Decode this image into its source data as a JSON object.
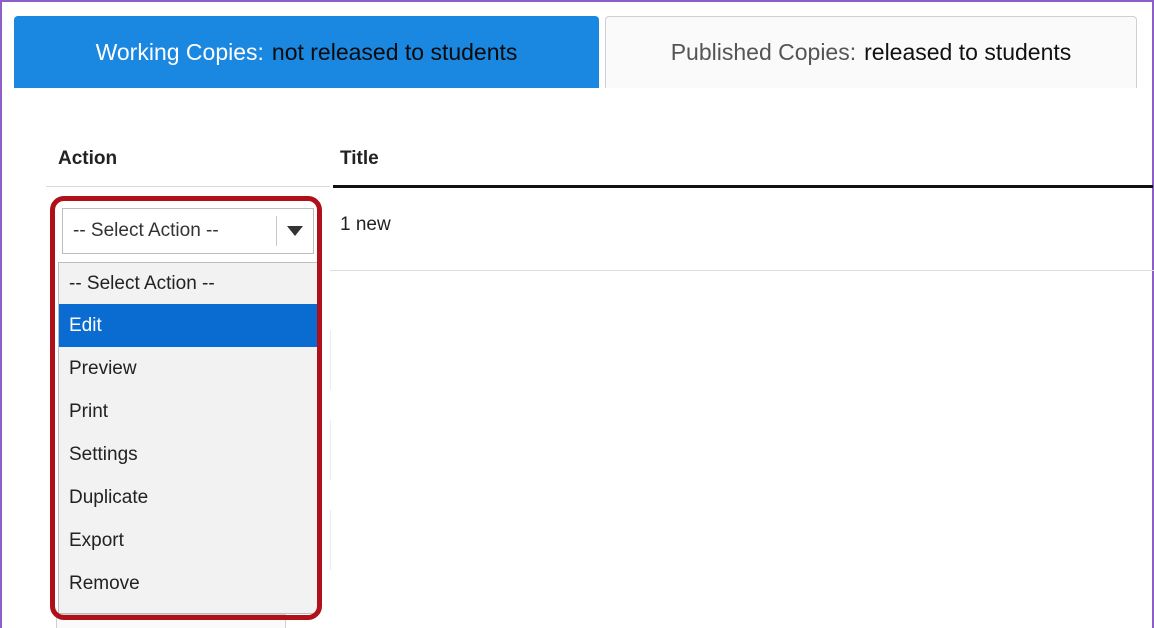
{
  "tabs": [
    {
      "prefix": "Working Copies:",
      "strong": "not released to students"
    },
    {
      "prefix": "Published Copies:",
      "strong": "released to students"
    }
  ],
  "table": {
    "headers": {
      "action": "Action",
      "title": "Title"
    },
    "rows": [
      {
        "title": "1 new",
        "action_value": "-- Select Action --"
      }
    ]
  },
  "dropdown": {
    "options": [
      "-- Select Action --",
      "Edit",
      "Preview",
      "Print",
      "Settings",
      "Duplicate",
      "Export",
      "Remove"
    ],
    "highlighted": "Edit"
  },
  "colors": {
    "active_tab": "#1a87e0",
    "selected_option": "#0a6bd0",
    "callout": "#b0101a",
    "frame": "#8b5fc7"
  },
  "icons": {
    "select_arrow": "caret-down-icon"
  }
}
